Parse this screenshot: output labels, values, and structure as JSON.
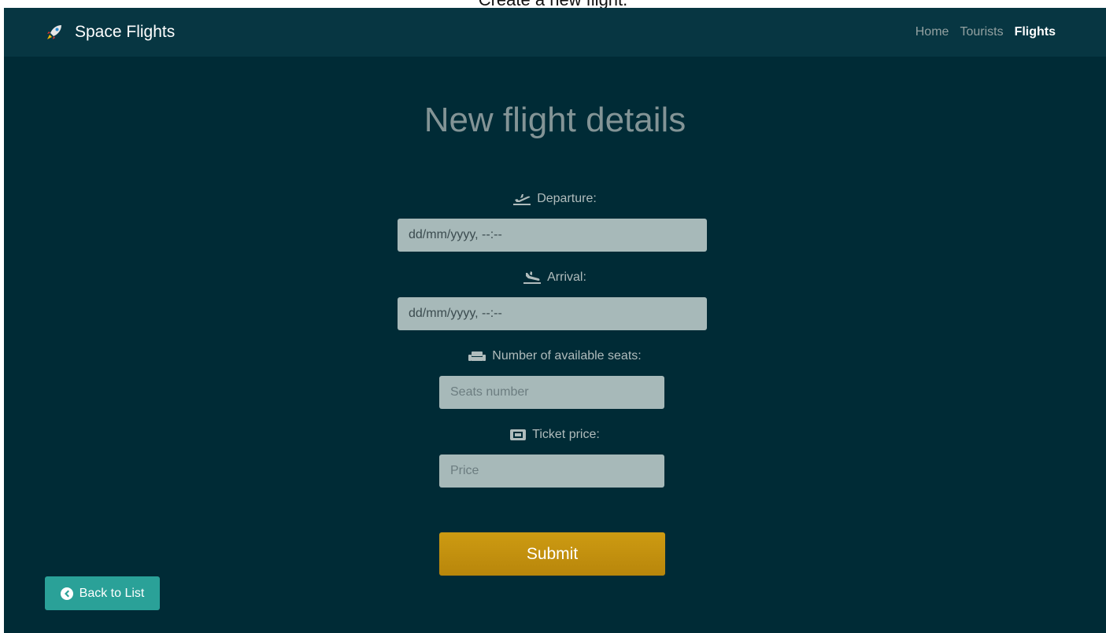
{
  "caption": "Create a new flight.",
  "navbar": {
    "brand": "Space Flights",
    "brand_icon": "rocket-icon",
    "links": [
      {
        "label": "Home",
        "active": false
      },
      {
        "label": "Tourists",
        "active": false
      },
      {
        "label": "Flights",
        "active": true
      }
    ]
  },
  "page": {
    "title": "New flight details"
  },
  "form": {
    "departure": {
      "label": "Departure:",
      "icon": "plane-departure-icon",
      "value": "dd/mm/yyyy, --:--"
    },
    "arrival": {
      "label": "Arrival:",
      "icon": "plane-arrival-icon",
      "value": "dd/mm/yyyy, --:--"
    },
    "seats": {
      "label": "Number of available seats:",
      "icon": "couch-icon",
      "placeholder": "Seats number"
    },
    "price": {
      "label": "Ticket price:",
      "icon": "ticket-icon",
      "placeholder": "Price"
    },
    "submit_label": "Submit"
  },
  "back_button": {
    "label": "Back to List",
    "icon": "arrow-circle-left-icon"
  },
  "colors": {
    "background": "#002b36",
    "navbar": "#073642",
    "input": "#a7b9b9",
    "submit": "#b8860b",
    "back": "#2aa198"
  }
}
